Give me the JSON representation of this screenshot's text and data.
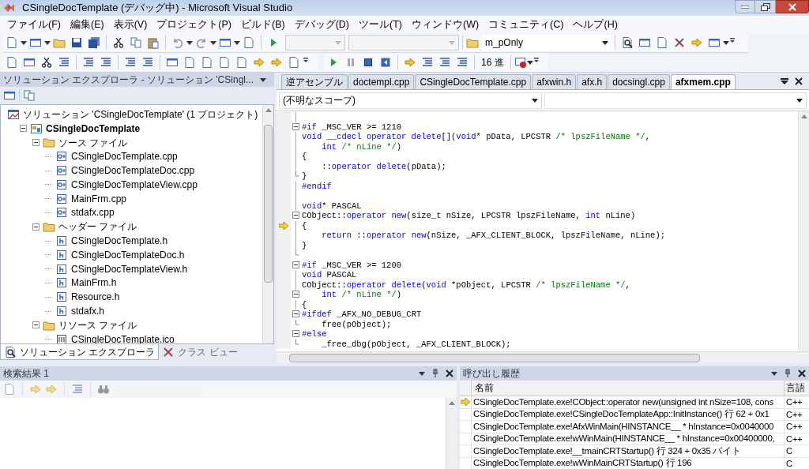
{
  "window": {
    "title": "CSingleDocTemplate (デバッグ中) - Microsoft Visual Studio"
  },
  "menu": [
    "ファイル(F)",
    "編集(E)",
    "表示(V)",
    "プロジェクト(P)",
    "ビルド(B)",
    "デバッグ(D)",
    "ツール(T)",
    "ウィンドウ(W)",
    "コミュニティ(C)",
    "ヘルプ(H)"
  ],
  "toolbar": {
    "find_combo": "m_pOnly",
    "hex_button": "16 進"
  },
  "solution_explorer": {
    "title": "ソリューション エクスプローラ - ソリューション 'CSingl...",
    "tree": [
      {
        "kind": "solution",
        "label": "ソリューション 'CSingleDocTemplate' (1 プロジェクト)",
        "children": [
          {
            "kind": "project",
            "label": "CSingleDocTemplate",
            "startup": true,
            "expanded": true,
            "children": [
              {
                "kind": "folder",
                "label": "ソース ファイル",
                "expanded": true,
                "children": [
                  {
                    "kind": "cpp",
                    "label": "CSingleDocTemplate.cpp"
                  },
                  {
                    "kind": "cpp",
                    "label": "CSingleDocTemplateDoc.cpp"
                  },
                  {
                    "kind": "cpp",
                    "label": "CSingleDocTemplateView.cpp"
                  },
                  {
                    "kind": "cpp",
                    "label": "MainFrm.cpp"
                  },
                  {
                    "kind": "cpp",
                    "label": "stdafx.cpp"
                  }
                ]
              },
              {
                "kind": "folder",
                "label": "ヘッダー ファイル",
                "expanded": true,
                "children": [
                  {
                    "kind": "h",
                    "label": "CSingleDocTemplate.h"
                  },
                  {
                    "kind": "h",
                    "label": "CSingleDocTemplateDoc.h"
                  },
                  {
                    "kind": "h",
                    "label": "CSingleDocTemplateView.h"
                  },
                  {
                    "kind": "h",
                    "label": "MainFrm.h"
                  },
                  {
                    "kind": "h",
                    "label": "Resource.h"
                  },
                  {
                    "kind": "h",
                    "label": "stdafx.h"
                  }
                ]
              },
              {
                "kind": "folder",
                "label": "リソース ファイル",
                "expanded": true,
                "children": [
                  {
                    "kind": "ico",
                    "label": "CSingleDocTemplate.ico"
                  }
                ]
              }
            ]
          }
        ]
      }
    ],
    "tabs": [
      {
        "label": "ソリューション エクスプローラ",
        "selected": true
      },
      {
        "label": "クラス ビュー",
        "selected": false
      }
    ]
  },
  "editor": {
    "tabs": [
      {
        "label": "逆アセンブル",
        "selected": false
      },
      {
        "label": "doctempl.cpp",
        "selected": false
      },
      {
        "label": "CSingleDocTemplate.cpp",
        "selected": false
      },
      {
        "label": "afxwin.h",
        "selected": false
      },
      {
        "label": "afx.h",
        "selected": false
      },
      {
        "label": "docsingl.cpp",
        "selected": false
      },
      {
        "label": "afxmem.cpp",
        "selected": true
      }
    ],
    "scope": "(不明なスコープ)",
    "lines": [
      {
        "current": false,
        "fold_start": false,
        "fold_end": false
      },
      {
        "current": false,
        "fold_start": true,
        "fold_end": false,
        "tokens": [
          {
            "kind": "kw",
            "text": "#if"
          },
          {
            "kind": "plain",
            "text": " _MSC_VER >= 1210"
          }
        ]
      },
      {
        "current": false,
        "fold_start": false,
        "fold_end": false,
        "tokens": [
          {
            "kind": "kw",
            "text": "void __cdecl operator delete"
          },
          {
            "kind": "plain",
            "text": "[]("
          },
          {
            "kind": "kw",
            "text": "void"
          },
          {
            "kind": "plain",
            "text": "* pData, LPCSTR "
          },
          {
            "kind": "comment",
            "text": "/* lpszFileName */"
          },
          {
            "kind": "plain",
            "text": ","
          }
        ]
      },
      {
        "current": false,
        "fold_start": false,
        "fold_end": false,
        "tokens": [
          {
            "kind": "kw",
            "text": "    int "
          },
          {
            "kind": "comment",
            "text": "/* nLine */"
          },
          {
            "kind": "plain",
            "text": ")"
          }
        ]
      },
      {
        "current": false,
        "fold_start": false,
        "fold_end": false,
        "tokens": [
          {
            "kind": "plain",
            "text": "{"
          }
        ]
      },
      {
        "current": false,
        "fold_start": false,
        "fold_end": false,
        "tokens": [
          {
            "kind": "plain",
            "text": "    ::"
          },
          {
            "kind": "kw",
            "text": "operator delete"
          },
          {
            "kind": "plain",
            "text": "(pData);"
          }
        ]
      },
      {
        "current": false,
        "fold_start": false,
        "fold_end": true,
        "tokens": [
          {
            "kind": "plain",
            "text": "}"
          }
        ]
      },
      {
        "current": false,
        "fold_start": false,
        "fold_end": false,
        "tokens": [
          {
            "kind": "kw",
            "text": "#endif"
          }
        ]
      },
      {
        "current": false,
        "fold_start": false,
        "fold_end": false
      },
      {
        "current": false,
        "fold_start": false,
        "fold_end": false,
        "tokens": [
          {
            "kind": "kw",
            "text": "void"
          },
          {
            "kind": "plain",
            "text": "* PASCAL"
          }
        ]
      },
      {
        "current": false,
        "fold_start": true,
        "fold_end": false,
        "tokens": [
          {
            "kind": "plain",
            "text": "CObject::"
          },
          {
            "kind": "kw",
            "text": "operator new"
          },
          {
            "kind": "plain",
            "text": "(size_t nSize, LPCSTR lpszFileName, "
          },
          {
            "kind": "kw",
            "text": "int"
          },
          {
            "kind": "plain",
            "text": " nLine)"
          }
        ]
      },
      {
        "current": true,
        "fold_start": false,
        "fold_end": false,
        "tokens": [
          {
            "kind": "plain",
            "text": "{"
          }
        ]
      },
      {
        "current": false,
        "fold_start": false,
        "fold_end": false,
        "tokens": [
          {
            "kind": "kw",
            "text": "    return"
          },
          {
            "kind": "plain",
            "text": " ::"
          },
          {
            "kind": "kw",
            "text": "operator new"
          },
          {
            "kind": "plain",
            "text": "(nSize, _AFX_CLIENT_BLOCK, lpszFileName, nLine);"
          }
        ]
      },
      {
        "current": false,
        "fold_start": false,
        "fold_end": false,
        "tokens": [
          {
            "kind": "plain",
            "text": "}"
          }
        ]
      },
      {
        "current": false,
        "fold_start": false,
        "fold_end": true
      },
      {
        "current": false,
        "fold_start": true,
        "fold_end": false,
        "tokens": [
          {
            "kind": "kw",
            "text": "#if"
          },
          {
            "kind": "plain",
            "text": " _MSC_VER >= 1200"
          }
        ]
      },
      {
        "current": false,
        "fold_start": false,
        "fold_end": false,
        "tokens": [
          {
            "kind": "kw",
            "text": "void"
          },
          {
            "kind": "plain",
            "text": " PASCAL"
          }
        ]
      },
      {
        "current": false,
        "fold_start": false,
        "fold_end": false,
        "tokens": [
          {
            "kind": "plain",
            "text": "CObject::"
          },
          {
            "kind": "kw",
            "text": "operator delete"
          },
          {
            "kind": "plain",
            "text": "("
          },
          {
            "kind": "kw",
            "text": "void"
          },
          {
            "kind": "plain",
            "text": " *pObject, LPCSTR "
          },
          {
            "kind": "comment",
            "text": "/* lpszFileName */"
          },
          {
            "kind": "plain",
            "text": ","
          }
        ]
      },
      {
        "current": false,
        "fold_start": true,
        "fold_end": false,
        "tokens": [
          {
            "kind": "kw",
            "text": "    int "
          },
          {
            "kind": "comment",
            "text": "/* nLine */"
          },
          {
            "kind": "plain",
            "text": ")"
          }
        ]
      },
      {
        "current": false,
        "fold_start": false,
        "fold_end": false,
        "tokens": [
          {
            "kind": "plain",
            "text": "{"
          }
        ]
      },
      {
        "current": false,
        "fold_start": true,
        "fold_end": false,
        "tokens": [
          {
            "kind": "kw",
            "text": "#ifdef"
          },
          {
            "kind": "plain",
            "text": " _AFX_NO_DEBUG_CRT"
          }
        ]
      },
      {
        "current": false,
        "fold_start": false,
        "fold_end": true,
        "tokens": [
          {
            "kind": "plain",
            "text": "    free(pObject);"
          }
        ]
      },
      {
        "current": false,
        "fold_start": true,
        "fold_end": false,
        "tokens": [
          {
            "kind": "kw",
            "text": "#else"
          }
        ]
      },
      {
        "current": false,
        "fold_start": false,
        "fold_end": true,
        "tokens": [
          {
            "kind": "plain",
            "text": "    _free_dbg(pObject, _AFX_CLIENT_BLOCK);"
          }
        ]
      }
    ]
  },
  "find_results": {
    "title": "検索結果 1"
  },
  "call_stack": {
    "title": "呼び出し履歴",
    "columns": [
      "名前",
      "言語"
    ],
    "rows": [
      {
        "name": "CSingleDocTemplate.exe!CObject::operator new(unsigned int nSize=108, cons",
        "language": "C++",
        "current": true
      },
      {
        "name": "CSingleDocTemplate.exe!CSingleDocTemplateApp::InitInstance()  行 62 + 0x1",
        "language": "C++",
        "current": false
      },
      {
        "name": "CSingleDocTemplate.exe!AfxWinMain(HINSTANCE__ * hInstance=0x0040000",
        "language": "C++",
        "current": false
      },
      {
        "name": "CSingleDocTemplate.exe!wWinMain(HINSTANCE__ * hInstance=0x00400000,",
        "language": "C++",
        "current": false
      },
      {
        "name": "CSingleDocTemplate.exe!__tmainCRTStartup()  行 324 + 0x35 バイト",
        "language": "C",
        "current": false
      },
      {
        "name": "CSingleDocTemplate.exe!wWinMainCRTStartup()  行 196",
        "language": "C",
        "current": false
      }
    ]
  }
}
